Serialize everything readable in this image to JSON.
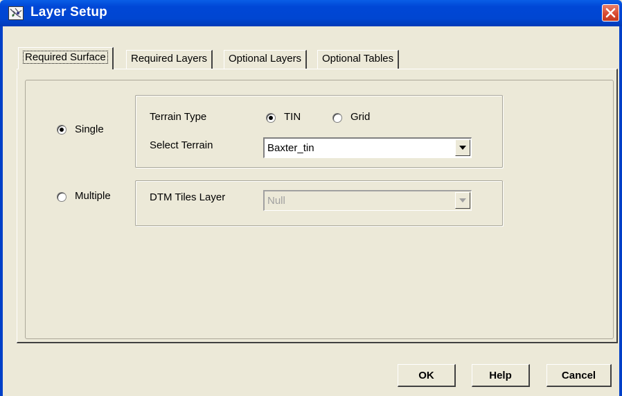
{
  "window": {
    "title": "Layer Setup",
    "app_icon": "layer-setup-icon",
    "close_icon": "close-icon"
  },
  "tabs": [
    {
      "label": "Required Surface",
      "active": true
    },
    {
      "label": "Required Layers",
      "active": false
    },
    {
      "label": "Optional Layers",
      "active": false
    },
    {
      "label": "Optional Tables",
      "active": false
    }
  ],
  "surface": {
    "single_label": "Single",
    "single_checked": true,
    "multiple_label": "Multiple",
    "multiple_checked": false,
    "terrain_type_label": "Terrain Type",
    "tin_label": "TIN",
    "tin_checked": true,
    "grid_label": "Grid",
    "grid_checked": false,
    "select_terrain_label": "Select Terrain",
    "select_terrain_value": "Baxter_tin",
    "dtm_tiles_label": "DTM Tiles Layer",
    "dtm_tiles_value": "Null",
    "dtm_tiles_enabled": false
  },
  "buttons": {
    "ok": "OK",
    "help": "Help",
    "cancel": "Cancel"
  },
  "colors": {
    "titlebar": "#0047d6",
    "close_button": "#d9482e",
    "dialog_bg": "#ece9d8"
  }
}
